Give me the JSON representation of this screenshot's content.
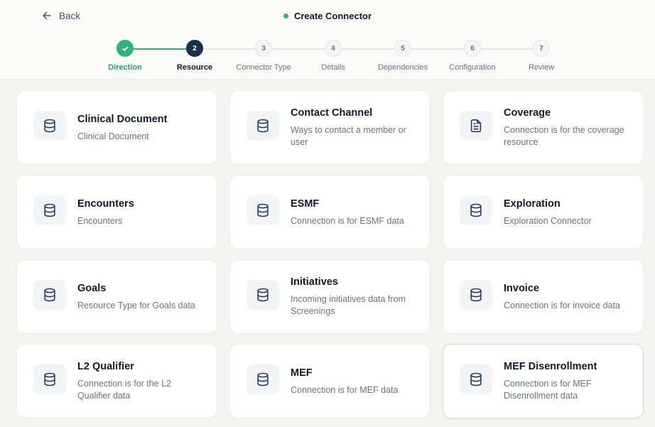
{
  "header": {
    "back_label": "Back",
    "title": "Create Connector",
    "status_color": "#2fb07a"
  },
  "stepper": {
    "current_step": 2,
    "steps": [
      {
        "number": "1",
        "label": "Direction",
        "state": "completed"
      },
      {
        "number": "2",
        "label": "Resource",
        "state": "current"
      },
      {
        "number": "3",
        "label": "Connector Type",
        "state": "upcoming"
      },
      {
        "number": "4",
        "label": "Details",
        "state": "upcoming"
      },
      {
        "number": "5",
        "label": "Dependencies",
        "state": "upcoming"
      },
      {
        "number": "6",
        "label": "Configuration",
        "state": "upcoming"
      },
      {
        "number": "7",
        "label": "Review",
        "state": "upcoming"
      }
    ]
  },
  "resources": [
    {
      "name": "Clinical Document",
      "description": "Clinical Document",
      "icon": "database-icon"
    },
    {
      "name": "Contact Channel",
      "description": "Ways to contact a member or user",
      "icon": "database-icon"
    },
    {
      "name": "Coverage",
      "description": "Connection is for the coverage resource",
      "icon": "document-icon"
    },
    {
      "name": "Encounters",
      "description": "Encounters",
      "icon": "database-icon"
    },
    {
      "name": "ESMF",
      "description": "Connection is for ESMF data",
      "icon": "database-icon"
    },
    {
      "name": "Exploration",
      "description": "Exploration Connector",
      "icon": "database-icon"
    },
    {
      "name": "Goals",
      "description": "Resource Type for Goals data",
      "icon": "database-icon"
    },
    {
      "name": "Initiatives",
      "description": "Incoming initiatives data from Screenings",
      "icon": "database-icon"
    },
    {
      "name": "Invoice",
      "description": "Connection is for invoice data",
      "icon": "database-icon"
    },
    {
      "name": "L2 Qualifier",
      "description": "Connection is for the L2 Qualifier data",
      "icon": "database-icon"
    },
    {
      "name": "MEF",
      "description": "Connection is for MEF data",
      "icon": "database-icon"
    },
    {
      "name": "MEF Disenrollment",
      "description": "Connection is for MEF Disenrollment data",
      "icon": "database-icon"
    }
  ],
  "colors": {
    "completed": "#34b27b",
    "current": "#15324d",
    "icon_stroke": "#1e3a5f"
  }
}
